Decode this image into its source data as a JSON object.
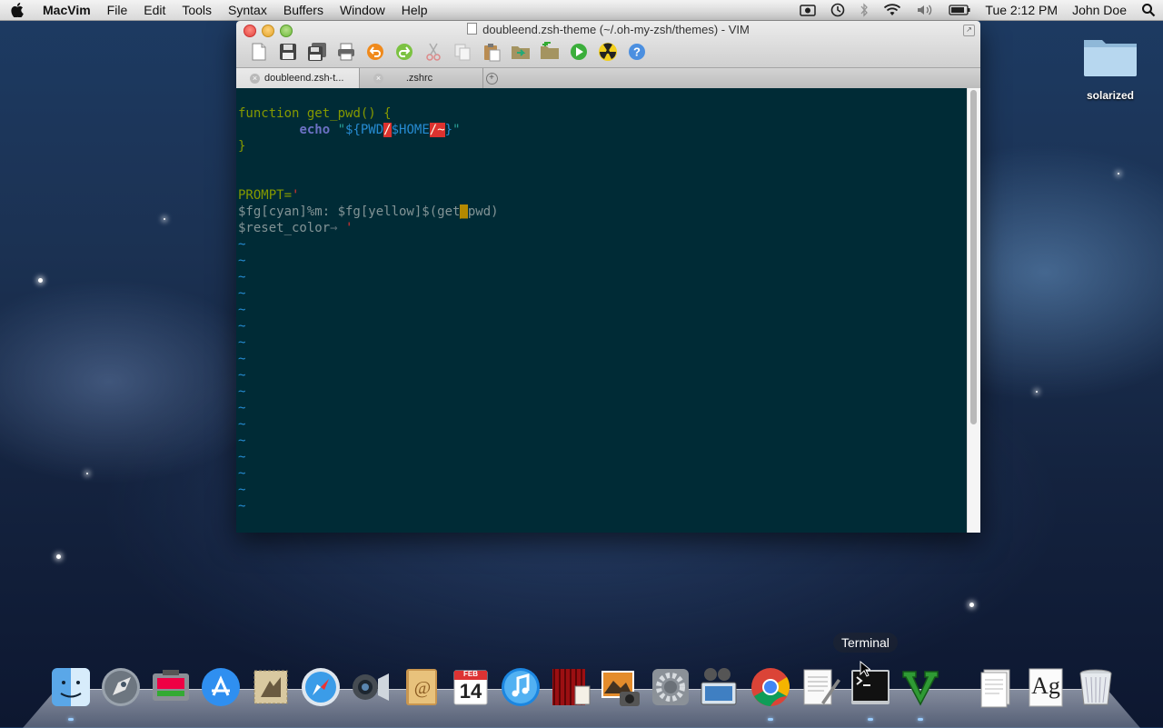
{
  "menubar": {
    "app_name": "MacVim",
    "menus": [
      "File",
      "Edit",
      "Tools",
      "Syntax",
      "Buffers",
      "Window",
      "Help"
    ],
    "clock": "Tue 2:12 PM",
    "user": "John Doe"
  },
  "desktop": {
    "folder_label": "solarized"
  },
  "window": {
    "title": "doubleend.zsh-theme (~/.oh-my-zsh/themes) - VIM",
    "tabs": [
      {
        "label": "doubleend.zsh-t..."
      },
      {
        "label": ".zshrc"
      }
    ]
  },
  "editor": {
    "l1_keyword": "function",
    "l1_rest": " get_pwd() {",
    "l2_indent": "        ",
    "l2_echo": "echo",
    "l2_q1": " \"",
    "l2_var1": "${PWD",
    "l2_slash1": "/",
    "l2_var2": "$HOME",
    "l2_slash2": "/~",
    "l2_close": "}",
    "l2_q2": "\"",
    "l3": "}",
    "l6_name": "PROMPT=",
    "l6_quote": "'",
    "l7_a": "$fg[cyan]%m: $fg[yellow]$(get",
    "l7_cursor": "_",
    "l7_b": "pwd)",
    "l8_a": "$reset_color",
    "l8_arrow": "→",
    "l8_b": " '",
    "tilde": "~"
  },
  "dock": {
    "tooltip": "Terminal",
    "calendar_day": "14",
    "calendar_month": "FEB",
    "ag_label": "Ag"
  },
  "colors": {
    "solarized_base03": "#002b36",
    "accent_green": "#859900",
    "accent_blue": "#268bd2",
    "accent_red": "#dc322f",
    "accent_yellow": "#b58900"
  }
}
